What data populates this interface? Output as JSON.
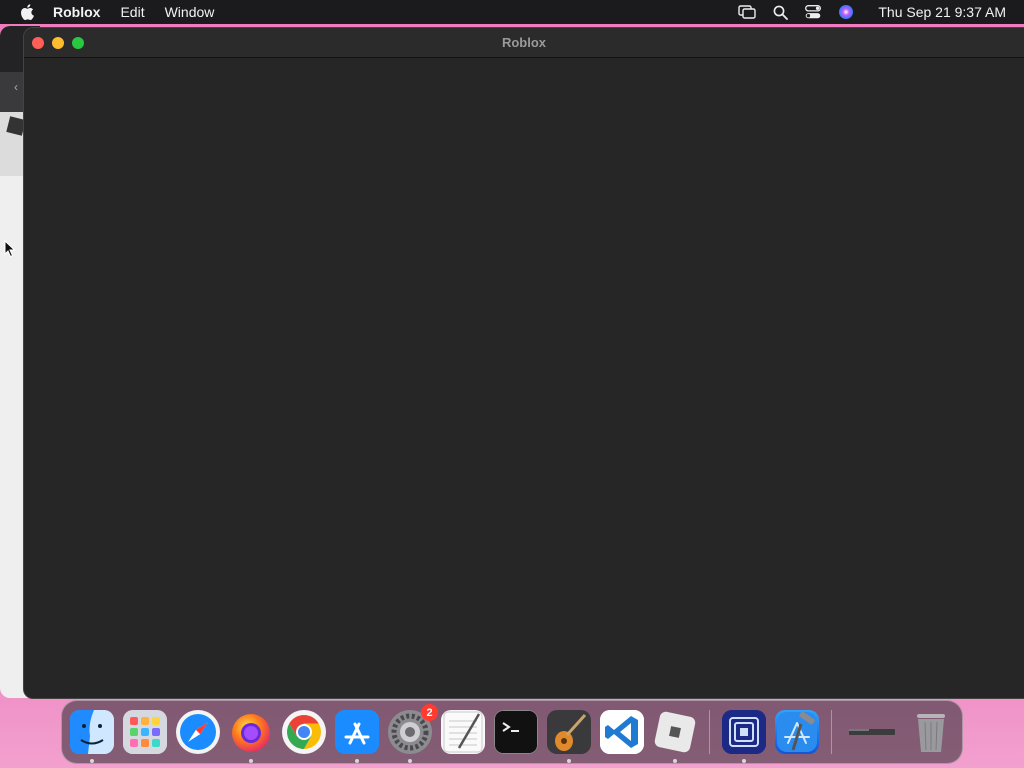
{
  "menubar": {
    "app_name": "Roblox",
    "items": [
      "Edit",
      "Window"
    ],
    "clock": "Thu Sep 21  9:37 AM",
    "status_icons": [
      "screen-mirroring-icon",
      "search-icon",
      "control-center-icon",
      "siri-icon"
    ]
  },
  "window": {
    "title": "Roblox"
  },
  "dock": {
    "apps": [
      {
        "name": "finder-icon",
        "running": true
      },
      {
        "name": "launchpad-icon",
        "running": false
      },
      {
        "name": "safari-icon",
        "running": false
      },
      {
        "name": "firefox-icon",
        "running": true
      },
      {
        "name": "chrome-icon",
        "running": false
      },
      {
        "name": "app-store-icon",
        "running": true
      },
      {
        "name": "system-settings-icon",
        "running": true,
        "badge": "2"
      },
      {
        "name": "textedit-icon",
        "running": false
      },
      {
        "name": "terminal-icon",
        "running": false
      },
      {
        "name": "garageband-icon",
        "running": true
      },
      {
        "name": "vscode-icon",
        "running": false
      },
      {
        "name": "roblox-icon",
        "running": true
      }
    ],
    "extra_apps": [
      {
        "name": "instruments-icon",
        "running": true
      },
      {
        "name": "xcode-icon",
        "running": false
      }
    ],
    "utility": [
      {
        "name": "minimized-window-icon"
      },
      {
        "name": "trash-icon"
      }
    ]
  },
  "colors": {
    "wallpaper": "#ea6fb2",
    "menubar": "#1b1b1d",
    "window_bg": "#262626",
    "traffic_red": "#ff5f57",
    "traffic_yellow": "#febc2e",
    "traffic_green": "#28c840"
  }
}
